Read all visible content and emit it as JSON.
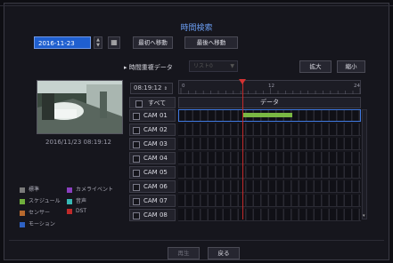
{
  "title": "時間検索",
  "date": {
    "value": "2016-11-23"
  },
  "buttons": {
    "first": "最初へ移動",
    "last": "最後へ移動",
    "zoom_in": "拡大",
    "zoom_out": "縮小",
    "ok": "再生",
    "back": "戻る"
  },
  "dup_label": "時間重複データ",
  "dup_select": "リスト0",
  "time_field": "08:19:12",
  "scale_labels": [
    "0",
    "12",
    "24"
  ],
  "all_label": "すべて",
  "data_header": "データ",
  "cams": [
    "CAM 01",
    "CAM 02",
    "CAM 03",
    "CAM 04",
    "CAM 05",
    "CAM 06",
    "CAM 07",
    "CAM 08"
  ],
  "recording": {
    "cam": "CAM 01",
    "start_hour": 8.5,
    "end_hour": 15.0,
    "color": "#7ab843"
  },
  "playhead_hour": 8.3,
  "timestamp": "2016/11/23 08:19:12",
  "legend": [
    {
      "label": "標準",
      "color": "#7a7a7a"
    },
    {
      "label": "カメライベント",
      "color": "#8a3fbf"
    },
    {
      "label": "スケジュール",
      "color": "#6fae3c"
    },
    {
      "label": "音声",
      "color": "#38b9b4"
    },
    {
      "label": "センサー",
      "color": "#b7692e"
    },
    {
      "label": "DST",
      "color": "#c02a2a"
    },
    {
      "label": "モーション",
      "color": "#2e62c4"
    }
  ]
}
